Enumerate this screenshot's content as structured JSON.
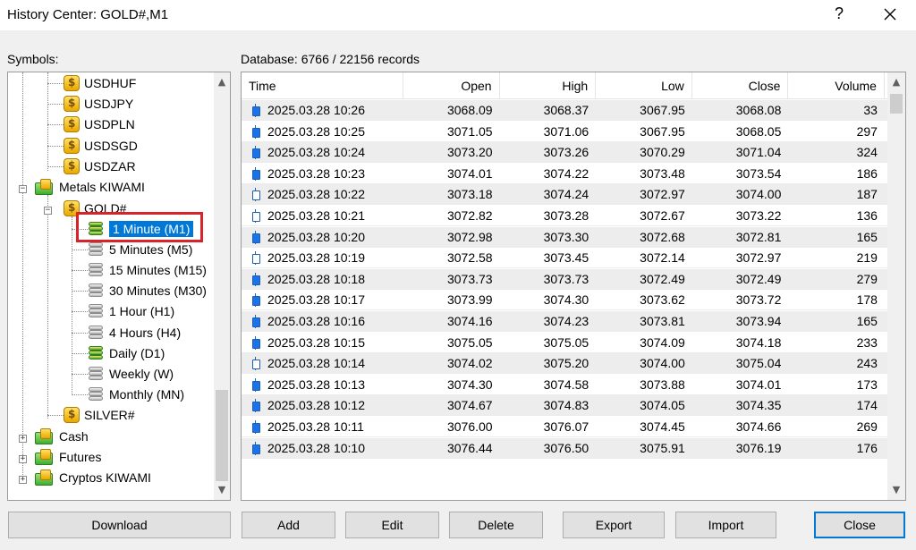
{
  "window": {
    "title": "History Center: GOLD#,M1",
    "help_label": "?"
  },
  "labels": {
    "symbols": "Symbols:",
    "database": "Database: 6766 / 22156 records"
  },
  "tree": {
    "currencies": [
      "USDHUF",
      "USDJPY",
      "USDPLN",
      "USDSGD",
      "USDZAR"
    ],
    "metals_group": "Metals KIWAMI",
    "gold": "GOLD#",
    "timeframes": [
      "1 Minute (M1)",
      "5 Minutes (M5)",
      "15 Minutes (M15)",
      "30 Minutes (M30)",
      "1 Hour (H1)",
      "4 Hours (H4)",
      "Daily (D1)",
      "Weekly (W)",
      "Monthly (MN)"
    ],
    "silver": "SILVER#",
    "groups": [
      "Cash",
      "Futures",
      "Cryptos KIWAMI"
    ]
  },
  "table": {
    "columns": [
      "Time",
      "Open",
      "High",
      "Low",
      "Close",
      "Volume"
    ],
    "rows": [
      [
        "2025.03.28 10:26",
        "3068.09",
        "3068.37",
        "3067.95",
        "3068.08",
        "33"
      ],
      [
        "2025.03.28 10:25",
        "3071.05",
        "3071.06",
        "3067.95",
        "3068.05",
        "297"
      ],
      [
        "2025.03.28 10:24",
        "3073.20",
        "3073.26",
        "3070.29",
        "3071.04",
        "324"
      ],
      [
        "2025.03.28 10:23",
        "3074.01",
        "3074.22",
        "3073.48",
        "3073.54",
        "186"
      ],
      [
        "2025.03.28 10:22",
        "3073.18",
        "3074.24",
        "3072.97",
        "3074.00",
        "187"
      ],
      [
        "2025.03.28 10:21",
        "3072.82",
        "3073.28",
        "3072.67",
        "3073.22",
        "136"
      ],
      [
        "2025.03.28 10:20",
        "3072.98",
        "3073.30",
        "3072.68",
        "3072.81",
        "165"
      ],
      [
        "2025.03.28 10:19",
        "3072.58",
        "3073.45",
        "3072.14",
        "3072.97",
        "219"
      ],
      [
        "2025.03.28 10:18",
        "3073.73",
        "3073.73",
        "3072.49",
        "3072.49",
        "279"
      ],
      [
        "2025.03.28 10:17",
        "3073.99",
        "3074.30",
        "3073.62",
        "3073.72",
        "178"
      ],
      [
        "2025.03.28 10:16",
        "3074.16",
        "3074.23",
        "3073.81",
        "3073.94",
        "165"
      ],
      [
        "2025.03.28 10:15",
        "3075.05",
        "3075.05",
        "3074.09",
        "3074.18",
        "233"
      ],
      [
        "2025.03.28 10:14",
        "3074.02",
        "3075.20",
        "3074.00",
        "3075.04",
        "243"
      ],
      [
        "2025.03.28 10:13",
        "3074.30",
        "3074.58",
        "3073.88",
        "3074.01",
        "173"
      ],
      [
        "2025.03.28 10:12",
        "3074.67",
        "3074.83",
        "3074.05",
        "3074.35",
        "174"
      ],
      [
        "2025.03.28 10:11",
        "3076.00",
        "3076.07",
        "3074.45",
        "3074.66",
        "269"
      ],
      [
        "2025.03.28 10:10",
        "3076.44",
        "3076.50",
        "3075.91",
        "3076.19",
        "176"
      ]
    ]
  },
  "buttons": {
    "download": "Download",
    "add": "Add",
    "edit": "Edit",
    "delete": "Delete",
    "export": "Export",
    "import": "Import",
    "close": "Close"
  },
  "colors": {
    "selection": "#0078d7",
    "highlight_box": "#d9232a",
    "candle": "#1a73e8"
  }
}
